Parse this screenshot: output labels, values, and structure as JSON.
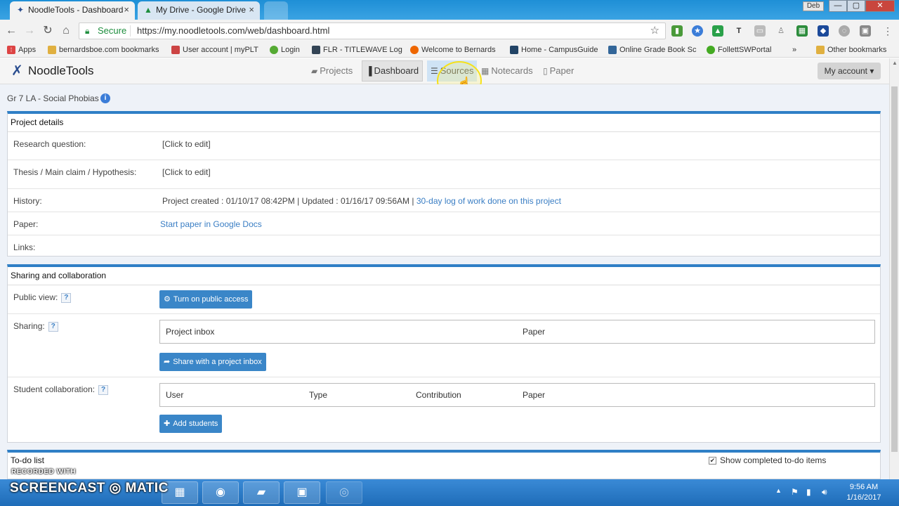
{
  "browser": {
    "tabs": [
      {
        "title": "NoodleTools - Dashboard",
        "close": "×"
      },
      {
        "title": "My Drive - Google Drive",
        "close": "×"
      }
    ],
    "window_user": "Deb",
    "window_buttons": [
      "—",
      "▢",
      "✕"
    ],
    "secure_label": "Secure",
    "url": "https://my.noodletools.com/web/dashboard.html",
    "bookmarks": [
      {
        "label": "Apps",
        "icon_color": "#d44"
      },
      {
        "label": "bernardsboe.com bookmarks",
        "icon_color": "#e0b040"
      },
      {
        "label": "User account | myPLT",
        "icon_color": "#c44"
      },
      {
        "label": "Login",
        "icon_color": "#5a3"
      },
      {
        "label": "FLR - TITLEWAVE Log",
        "icon_color": "#345"
      },
      {
        "label": "Welcome to Bernards",
        "icon_color": "#e60"
      },
      {
        "label": "Home - CampusGuide",
        "icon_color": "#246"
      },
      {
        "label": "Online Grade Book Sc",
        "icon_color": "#369"
      },
      {
        "label": "FollettSWPortal",
        "icon_color": "#4a2"
      },
      {
        "label": "»",
        "icon_color": ""
      },
      {
        "label": "Other bookmarks",
        "icon_color": "#e0b040"
      }
    ]
  },
  "app": {
    "logo": "NoodleTools",
    "nav": [
      {
        "label": "Projects",
        "icon": "folder-icon"
      },
      {
        "label": "Dashboard",
        "icon": "bar-chart-icon"
      },
      {
        "label": "Sources",
        "icon": "list-icon"
      },
      {
        "label": "Notecards",
        "icon": "grid-icon"
      },
      {
        "label": "Paper",
        "icon": "file-icon"
      }
    ],
    "account_button": "My account ▾"
  },
  "project": {
    "title": "Gr 7 LA - Social Phobias",
    "info_icon": "i"
  },
  "details": {
    "heading": "Project details",
    "rows": [
      {
        "label": "Research question:",
        "value": "[Click to edit]"
      },
      {
        "label": "Thesis / Main claim / Hypothesis:",
        "value": "[Click to edit]"
      },
      {
        "label": "History:",
        "value": "Project created : 01/10/17 08:42PM | Updated : 01/16/17 09:56AM |",
        "link": "30-day log of work done on this project"
      },
      {
        "label": "Paper:",
        "link": "Start paper in Google Docs"
      },
      {
        "label": "Links:"
      }
    ]
  },
  "sharing": {
    "heading": "Sharing and collaboration",
    "public_view_label": "Public view:",
    "public_button": "Turn on public access",
    "sharing_label": "Sharing:",
    "sharing_columns": [
      "Project inbox",
      "Paper"
    ],
    "share_button": "Share with a project inbox",
    "collab_label": "Student collaboration:",
    "collab_columns": [
      "User",
      "Type",
      "Contribution",
      "Paper"
    ],
    "add_button": "Add students",
    "help": "?"
  },
  "todo": {
    "heading": "To-do list",
    "show_completed": "Show completed to-do items",
    "checked": "✔"
  },
  "taskbar": {
    "time": "9:56 AM",
    "date": "1/16/2017",
    "recorded_with": "RECORDED WITH",
    "screencast": "SCREENCAST",
    "matic": "MATIC"
  }
}
